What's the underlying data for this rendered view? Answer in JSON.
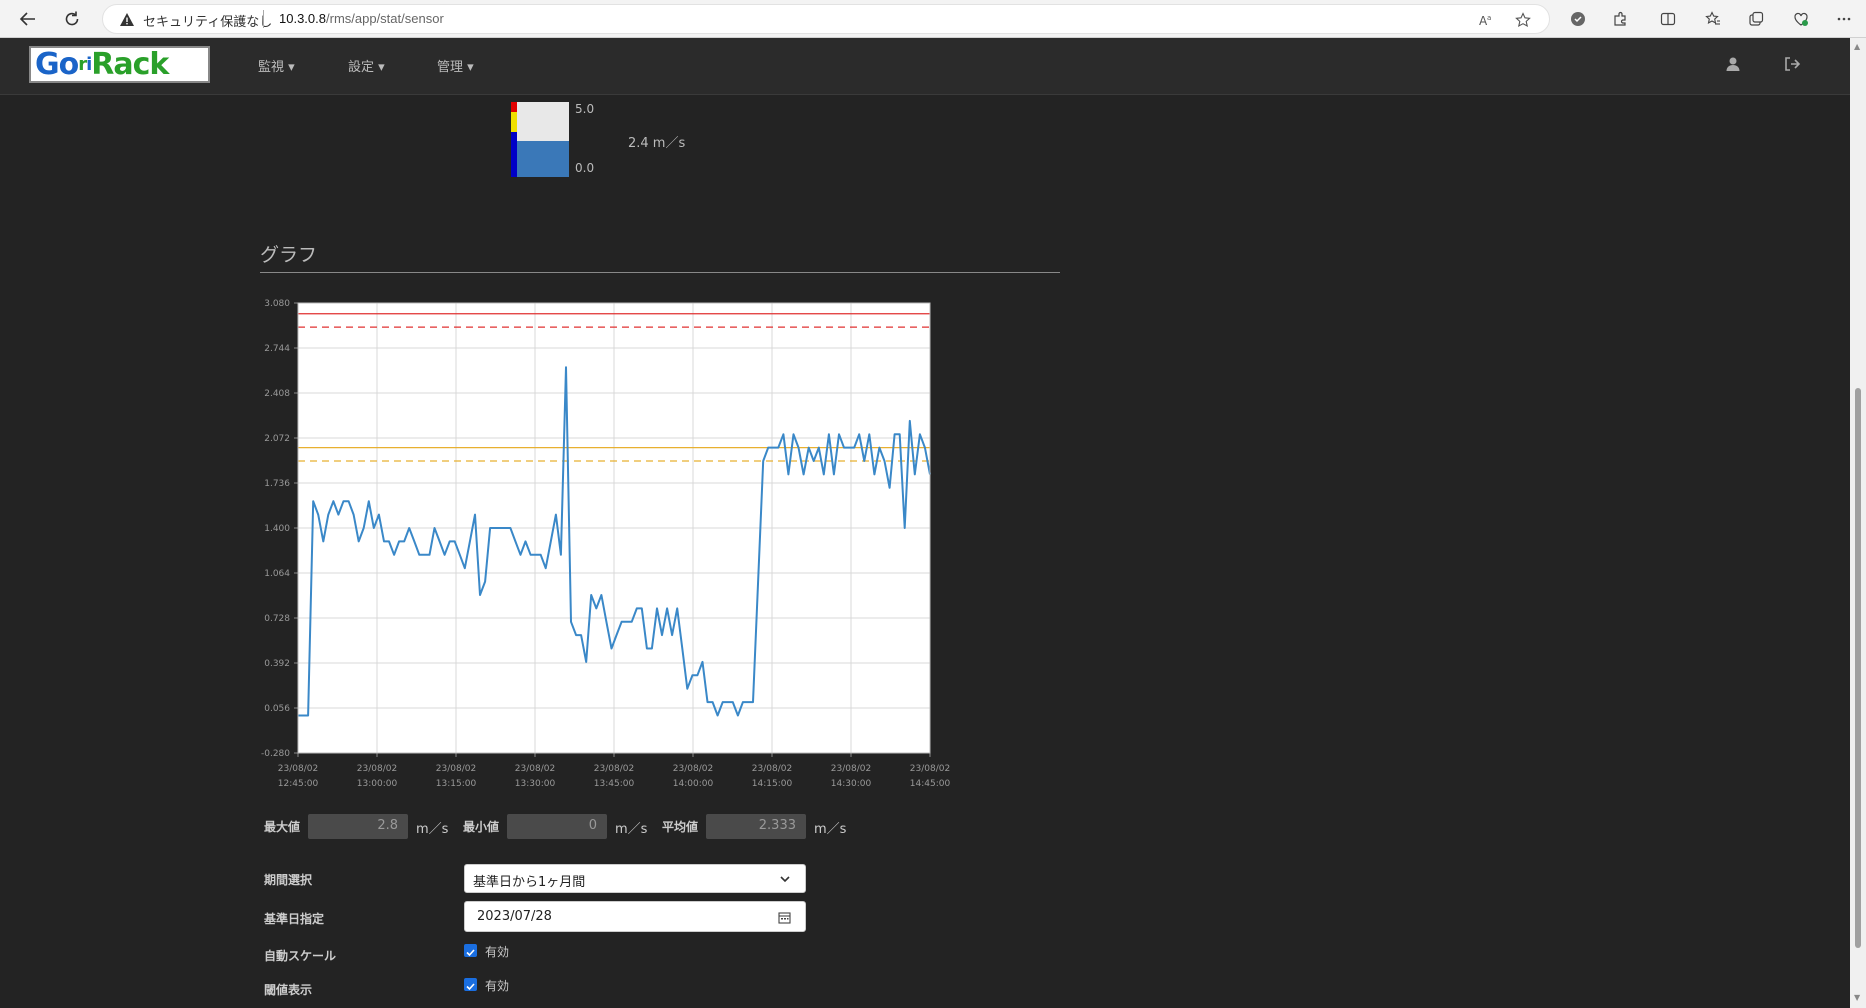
{
  "browser": {
    "security_label": "セキュリティ保護なし",
    "url_host": "10.3.0.8",
    "url_path": "/rms/app/stat/sensor"
  },
  "navbar": {
    "logo_text": "GoriRack",
    "menu": [
      {
        "label": "監視"
      },
      {
        "label": "設定"
      },
      {
        "label": "管理"
      }
    ],
    "icons": [
      "user-icon",
      "logout-icon"
    ]
  },
  "gauge": {
    "max": "5.0",
    "min": "0.0",
    "value_text": "2.4 m／s",
    "fill_fraction": 0.48,
    "colors": {
      "red": "#e00000",
      "yellow": "#f0e000",
      "blue": "#0000c8",
      "fill": "#3a78b8"
    }
  },
  "section": {
    "title": "グラフ"
  },
  "chart_data": {
    "type": "line",
    "ylim": [
      -0.28,
      3.08
    ],
    "yticks": [
      "3.080",
      "2.744",
      "2.408",
      "2.072",
      "1.736",
      "1.400",
      "1.064",
      "0.728",
      "0.392",
      "0.056",
      "-0.280"
    ],
    "xticks": [
      {
        "date": "23/08/02",
        "time": "12:45:00"
      },
      {
        "date": "23/08/02",
        "time": "13:00:00"
      },
      {
        "date": "23/08/02",
        "time": "13:15:00"
      },
      {
        "date": "23/08/02",
        "time": "13:30:00"
      },
      {
        "date": "23/08/02",
        "time": "13:45:00"
      },
      {
        "date": "23/08/02",
        "time": "14:00:00"
      },
      {
        "date": "23/08/02",
        "time": "14:15:00"
      },
      {
        "date": "23/08/02",
        "time": "14:30:00"
      },
      {
        "date": "23/08/02",
        "time": "14:45:00"
      }
    ],
    "thresholds": [
      {
        "value": 3.0,
        "color": "#e03030",
        "style": "solid"
      },
      {
        "value": 2.9,
        "color": "#e03030",
        "style": "dashed"
      },
      {
        "value": 2.0,
        "color": "#e8b030",
        "style": "solid"
      },
      {
        "value": 1.9,
        "color": "#e8b030",
        "style": "dashed"
      }
    ],
    "series": [
      {
        "color": "#3a88c8",
        "values": [
          0.0,
          0.0,
          0.0,
          1.6,
          1.5,
          1.3,
          1.5,
          1.6,
          1.5,
          1.6,
          1.6,
          1.5,
          1.3,
          1.4,
          1.6,
          1.4,
          1.5,
          1.3,
          1.3,
          1.2,
          1.3,
          1.3,
          1.4,
          1.3,
          1.2,
          1.2,
          1.2,
          1.4,
          1.3,
          1.2,
          1.3,
          1.3,
          1.2,
          1.1,
          1.3,
          1.5,
          0.9,
          1.0,
          1.4,
          1.4,
          1.4,
          1.4,
          1.4,
          1.3,
          1.2,
          1.3,
          1.2,
          1.2,
          1.2,
          1.1,
          1.3,
          1.5,
          1.2,
          2.6,
          0.7,
          0.6,
          0.6,
          0.4,
          0.9,
          0.8,
          0.9,
          0.7,
          0.5,
          0.6,
          0.7,
          0.7,
          0.7,
          0.8,
          0.8,
          0.5,
          0.5,
          0.8,
          0.6,
          0.8,
          0.6,
          0.8,
          0.5,
          0.2,
          0.3,
          0.3,
          0.4,
          0.1,
          0.1,
          0.0,
          0.1,
          0.1,
          0.1,
          0.0,
          0.1,
          0.1,
          0.1,
          1.0,
          1.9,
          2.0,
          2.0,
          2.0,
          2.1,
          1.8,
          2.1,
          2.0,
          1.8,
          2.0,
          1.9,
          2.0,
          1.8,
          2.1,
          1.8,
          2.1,
          2.0,
          2.0,
          2.0,
          2.1,
          1.9,
          2.1,
          1.8,
          2.0,
          1.9,
          1.7,
          2.1,
          2.1,
          1.4,
          2.2,
          1.8,
          2.1,
          2.0,
          1.8
        ]
      }
    ]
  },
  "stats": {
    "max_label": "最大値",
    "max_value": "2.8",
    "min_label": "最小値",
    "min_value": "0",
    "avg_label": "平均値",
    "avg_value": "2.333",
    "unit": "m／s"
  },
  "form": {
    "period_label": "期間選択",
    "period_value": "基準日から1ヶ月間",
    "base_date_label": "基準日指定",
    "base_date_value": "2023/07/28",
    "autoscale_label": "自動スケール",
    "autoscale_option": "有効",
    "threshold_label": "閾値表示",
    "threshold_option": "有効"
  }
}
